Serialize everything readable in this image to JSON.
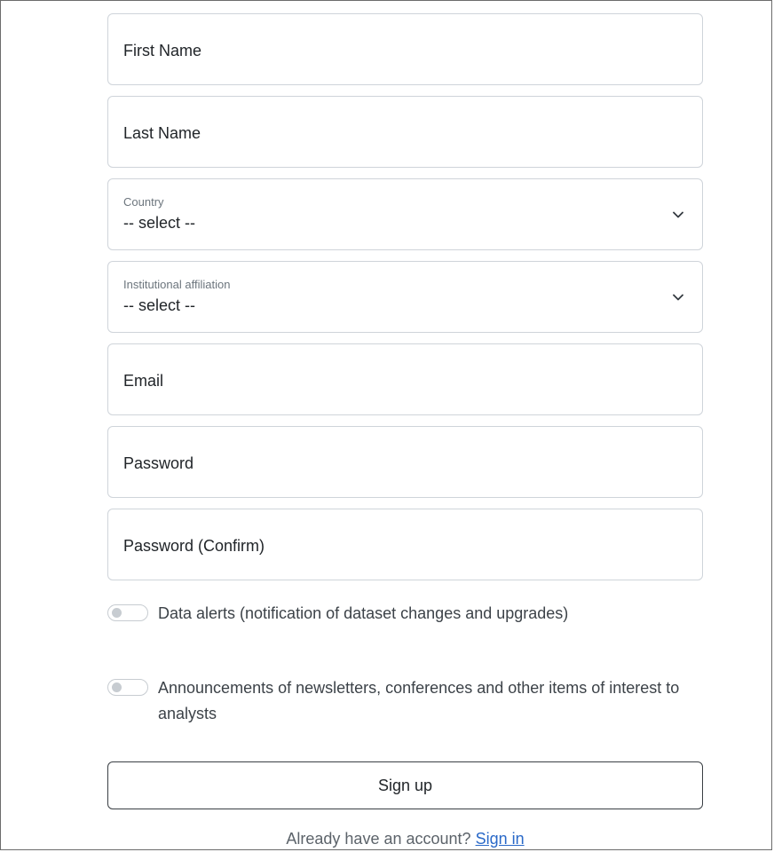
{
  "form": {
    "first_name": {
      "placeholder": "First Name"
    },
    "last_name": {
      "placeholder": "Last Name"
    },
    "country": {
      "label": "Country",
      "value": "-- select --"
    },
    "affiliation": {
      "label": "Institutional affiliation",
      "value": "-- select --"
    },
    "email": {
      "placeholder": "Email"
    },
    "password": {
      "placeholder": "Password"
    },
    "password_confirm": {
      "placeholder": "Password (Confirm)"
    }
  },
  "toggles": {
    "data_alerts": {
      "label": "Data alerts (notification of dataset changes and upgrades)",
      "enabled": false
    },
    "announcements": {
      "label": "Announcements of newsletters, conferences and other items of interest to analysts",
      "enabled": false
    }
  },
  "actions": {
    "signup_label": "Sign up",
    "already_text": "Already have an account?",
    "signin_label": "Sign in"
  },
  "icons": {
    "dropdown": "chevron-down-icon"
  },
  "colors": {
    "border": "#cfd4da",
    "link": "#2a69c8",
    "button_border": "#3a3f44"
  }
}
